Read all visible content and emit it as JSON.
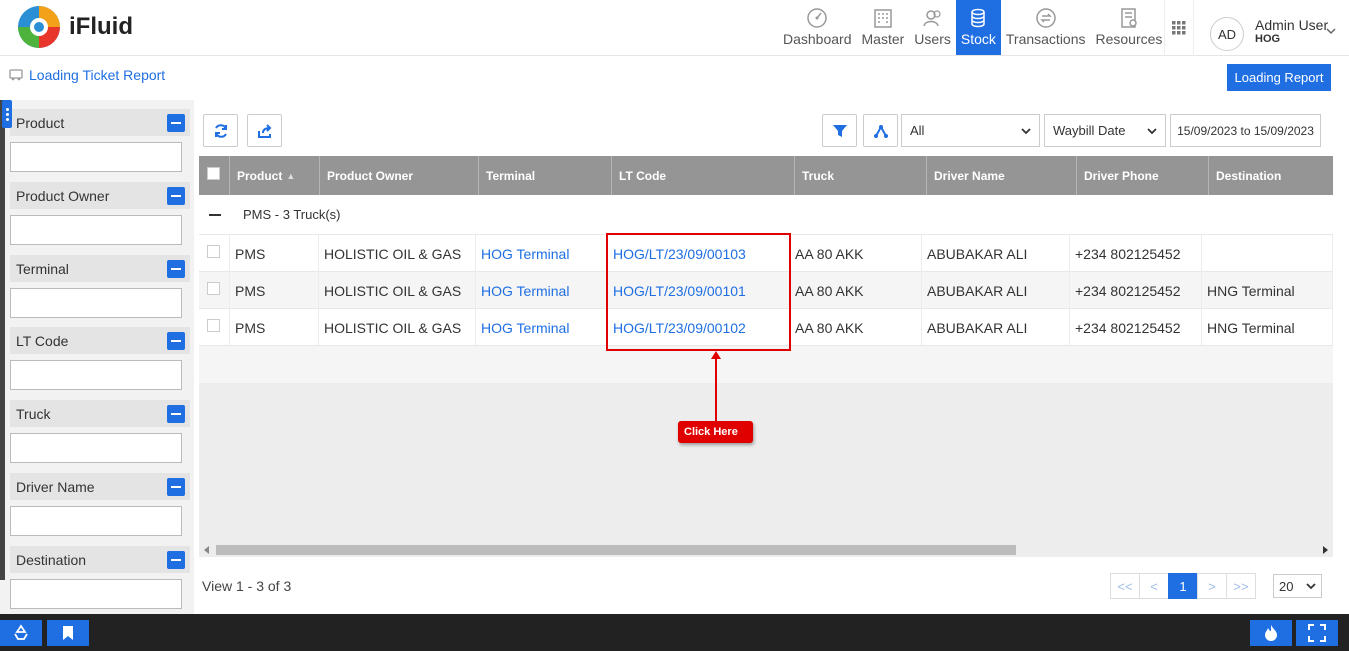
{
  "app": {
    "brand": "iFluid"
  },
  "nav": {
    "items": [
      {
        "label": "Dashboard",
        "icon": "dashboard-icon"
      },
      {
        "label": "Master",
        "icon": "building-icon"
      },
      {
        "label": "Users",
        "icon": "users-icon"
      },
      {
        "label": "Stock",
        "icon": "stock-icon",
        "active": true
      },
      {
        "label": "Transactions",
        "icon": "transactions-icon"
      },
      {
        "label": "Resources",
        "icon": "resources-icon"
      }
    ]
  },
  "user": {
    "initials": "AD",
    "name": "Admin User",
    "org": "HOG"
  },
  "page": {
    "breadcrumb": "Loading Ticket Report",
    "report_button": "Loading Report"
  },
  "filters": [
    {
      "label": "Product",
      "value": ""
    },
    {
      "label": "Product Owner",
      "value": ""
    },
    {
      "label": "Terminal",
      "value": ""
    },
    {
      "label": "LT Code",
      "value": ""
    },
    {
      "label": "Truck",
      "value": ""
    },
    {
      "label": "Driver Name",
      "value": ""
    },
    {
      "label": "Destination",
      "value": ""
    }
  ],
  "toolbar": {
    "status_select": "All",
    "date_field_select": "Waybill Date",
    "date_range": "15/09/2023 to 15/09/2023"
  },
  "table": {
    "columns": [
      "Product",
      "Product Owner",
      "Terminal",
      "LT Code",
      "Truck",
      "Driver Name",
      "Driver Phone",
      "Destination"
    ],
    "group_label": "PMS - 3 Truck(s)",
    "rows": [
      {
        "product": "PMS",
        "owner": "HOLISTIC OIL & GAS",
        "terminal": "HOG Terminal",
        "lt_code": "HOG/LT/23/09/00103",
        "truck": "AA 80 AKK",
        "driver": "ABUBAKAR ALI",
        "phone": "+234 802125452",
        "destination": ""
      },
      {
        "product": "PMS",
        "owner": "HOLISTIC OIL & GAS",
        "terminal": "HOG Terminal",
        "lt_code": "HOG/LT/23/09/00101",
        "truck": "AA 80 AKK",
        "driver": "ABUBAKAR ALI",
        "phone": "+234 802125452",
        "destination": "HNG Terminal"
      },
      {
        "product": "PMS",
        "owner": "HOLISTIC OIL & GAS",
        "terminal": "HOG Terminal",
        "lt_code": "HOG/LT/23/09/00102",
        "truck": "AA 80 AKK",
        "driver": "ABUBAKAR ALI",
        "phone": "+234 802125452",
        "destination": "HNG Terminal"
      }
    ]
  },
  "pagination": {
    "view_text": "View 1 - 3 of 3",
    "first": "<<",
    "prev": "<",
    "current": "1",
    "next": ">",
    "last": ">>",
    "page_size": "20"
  },
  "annotation": {
    "label": "Click Here",
    "color": "#e00000"
  },
  "colors": {
    "accent": "#1f6fe3",
    "header_gray": "#959595"
  }
}
